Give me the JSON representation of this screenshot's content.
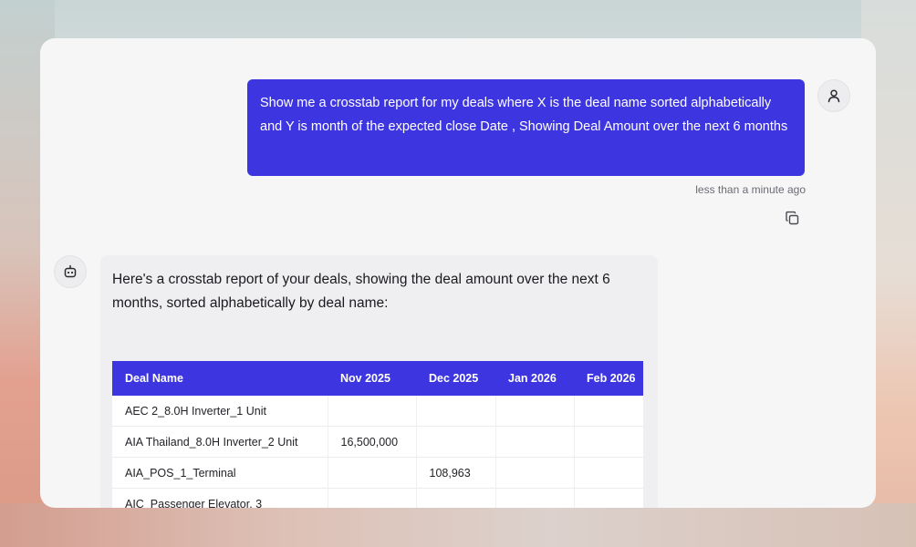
{
  "conversation": {
    "user_message": {
      "text": "Show me a crosstab report for my deals where X is the deal name sorted alphabetically and Y is month of the expected close Date , Showing Deal Amount over the next 6 months",
      "timestamp": "less than a minute ago"
    },
    "assistant_message": {
      "text": "Here's a crosstab report of your deals, showing the deal amount over the next 6 months, sorted alphabetically by deal name:"
    }
  },
  "icons": {
    "user_avatar": "user-icon",
    "assistant_avatar": "robot-icon",
    "copy": "copy-icon"
  },
  "colors": {
    "accent": "#3d35e0",
    "user_text": "#ffffff"
  },
  "table": {
    "columns": [
      "Deal Name",
      "Nov 2025",
      "Dec 2025",
      "Jan 2026",
      "Feb 2026"
    ],
    "rows": [
      [
        "AEC 2_8.0H Inverter_1 Unit",
        "",
        "",
        "",
        ""
      ],
      [
        "AIA Thailand_8.0H Inverter_2 Unit",
        "16,500,000",
        "",
        "",
        ""
      ],
      [
        "AIA_POS_1_Terminal",
        "",
        "108,963",
        "",
        ""
      ],
      [
        "AIC_Passenger Elevator, 3",
        "",
        "",
        "",
        ""
      ]
    ]
  }
}
